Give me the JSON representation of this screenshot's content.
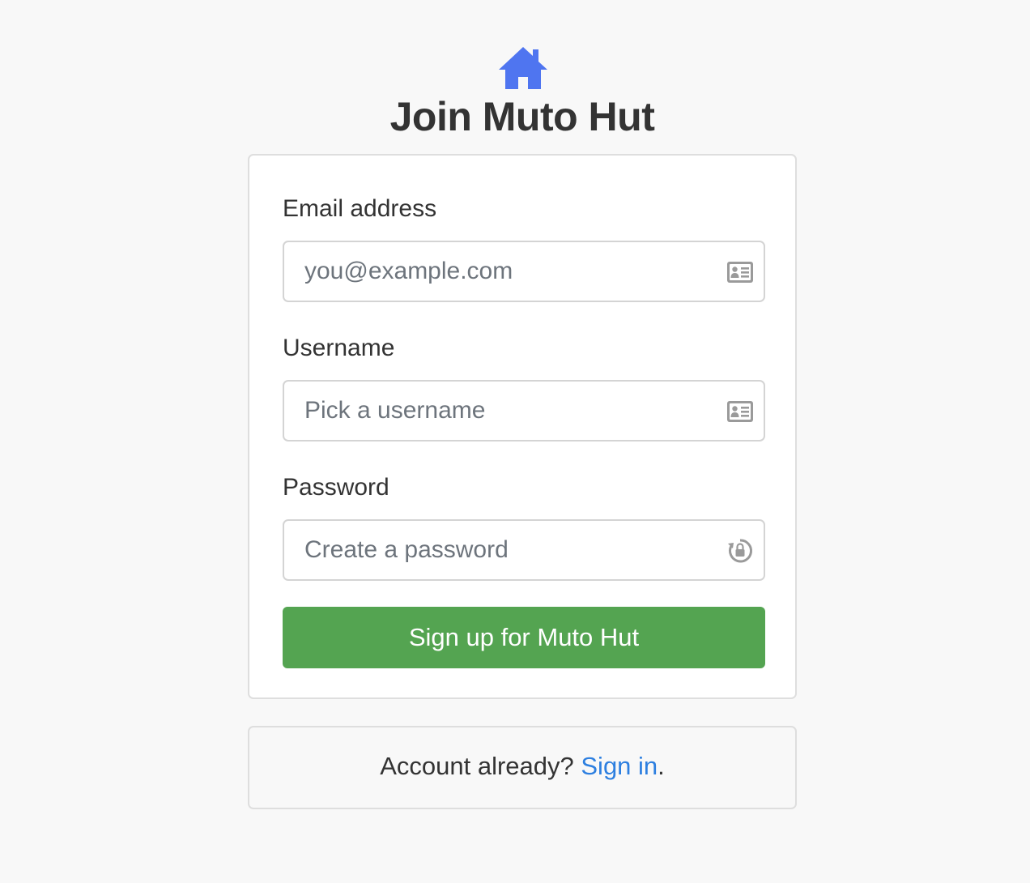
{
  "header": {
    "logo_icon": "house-icon",
    "logo_color": "#4f75f0",
    "title": "Join Muto Hut"
  },
  "form": {
    "email": {
      "label": "Email address",
      "value": "",
      "placeholder": "you@example.com",
      "icon": "id-card-icon"
    },
    "username": {
      "label": "Username",
      "value": "",
      "placeholder": "Pick a username",
      "icon": "id-card-icon"
    },
    "password": {
      "label": "Password",
      "value": "",
      "placeholder": "Create a password",
      "icon": "lock-refresh-icon"
    },
    "submit_label": "Sign up for Muto Hut",
    "submit_color": "#54a451"
  },
  "footer": {
    "prompt": "Account already?",
    "link_label": "Sign in",
    "suffix": ".",
    "link_color": "#2d7fe0"
  }
}
